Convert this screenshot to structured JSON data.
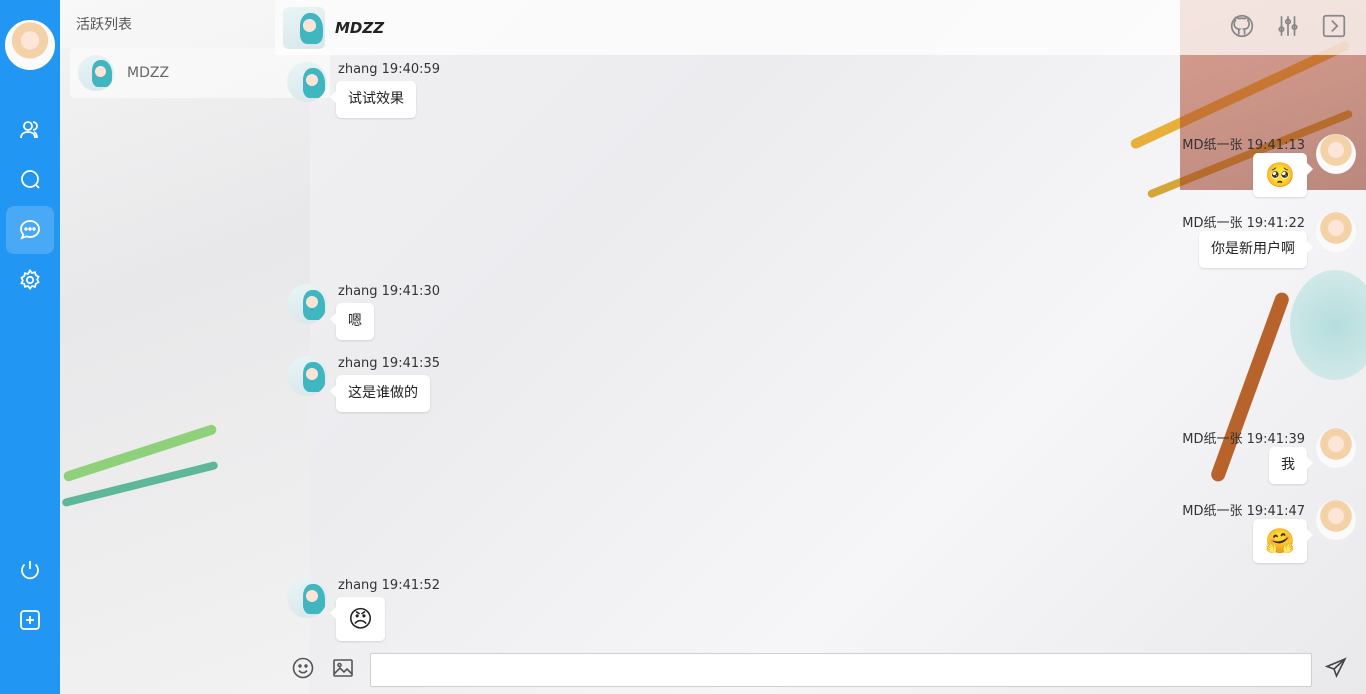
{
  "sidebar": {
    "accent": "#2196f3",
    "nav_top": [
      {
        "icon": "contacts-icon"
      },
      {
        "icon": "search-icon"
      },
      {
        "icon": "chat-icon",
        "active": true
      },
      {
        "icon": "settings-icon"
      }
    ],
    "nav_bottom": [
      {
        "icon": "power-icon"
      },
      {
        "icon": "add-icon"
      }
    ]
  },
  "active_list": {
    "title": "活跃列表",
    "items": [
      {
        "name": "MDZZ"
      }
    ]
  },
  "header": {
    "title": "MDZZ",
    "icons": [
      "github-icon",
      "sliders-icon",
      "collapse-icon"
    ]
  },
  "messages": [
    {
      "side": "left",
      "sender": "zhang",
      "time": "19:40:59",
      "meta": "zhang 19:40:59",
      "text": "试试效果"
    },
    {
      "side": "right",
      "sender": "MD纸一张",
      "time": "19:41:13",
      "meta": "MD纸一张 19:41:13",
      "emoji": "🥺"
    },
    {
      "side": "right",
      "sender": "MD纸一张",
      "time": "19:41:22",
      "meta": "MD纸一张 19:41:22",
      "text": "你是新用户啊"
    },
    {
      "side": "left",
      "sender": "zhang",
      "time": "19:41:30",
      "meta": "zhang 19:41:30",
      "text": "嗯"
    },
    {
      "side": "left",
      "sender": "zhang",
      "time": "19:41:35",
      "meta": "zhang 19:41:35",
      "text": "这是谁做的"
    },
    {
      "side": "right",
      "sender": "MD纸一张",
      "time": "19:41:39",
      "meta": "MD纸一张 19:41:39",
      "text": "我"
    },
    {
      "side": "right",
      "sender": "MD纸一张",
      "time": "19:41:47",
      "meta": "MD纸一张 19:41:47",
      "emoji": "🤗"
    },
    {
      "side": "left",
      "sender": "zhang",
      "time": "19:41:52",
      "meta": "zhang 19:41:52",
      "emoji": "😠"
    }
  ],
  "input": {
    "value": "",
    "tools": [
      "emoji-icon",
      "image-icon"
    ],
    "send_icon": "send-icon"
  }
}
